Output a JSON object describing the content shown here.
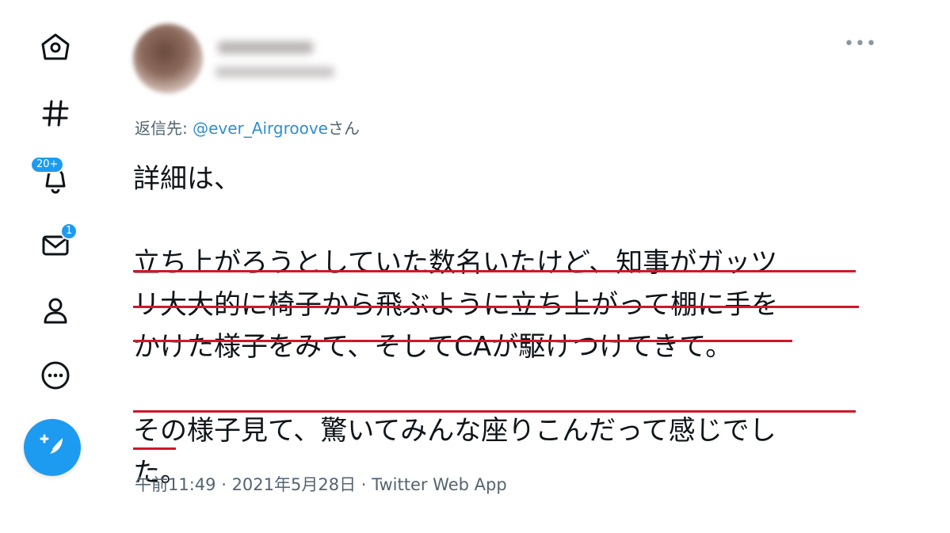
{
  "nav": {
    "items": [
      {
        "name": "home-icon"
      },
      {
        "name": "hashtag-icon"
      },
      {
        "name": "bell-icon",
        "badge": "20+"
      },
      {
        "name": "mail-icon",
        "badge": "1"
      },
      {
        "name": "profile-icon"
      },
      {
        "name": "more-circle-icon"
      }
    ],
    "compose_icon": "feather-plus-icon"
  },
  "tweet": {
    "reply_prefix": "返信先: ",
    "reply_to": "@ever_Airgroove",
    "reply_suffix": "さん",
    "lines": [
      "詳細は、",
      "",
      "立ち上がろうとしていた数名いたけど、知事がガッツ",
      "リ大大的に椅子から飛ぶように立ち上がって棚に手を",
      "かけた様子をみて、そしてCAが駆けつけてきて。",
      "",
      "その様子見て、驚いてみんな座りこんだって感じでし",
      "た。"
    ],
    "time": "午前11:49",
    "separator": " · ",
    "date": "2021年5月28日",
    "source": "Twitter Web App",
    "accent_color": "#1d9bf0",
    "underline_color": "#d0172a"
  }
}
